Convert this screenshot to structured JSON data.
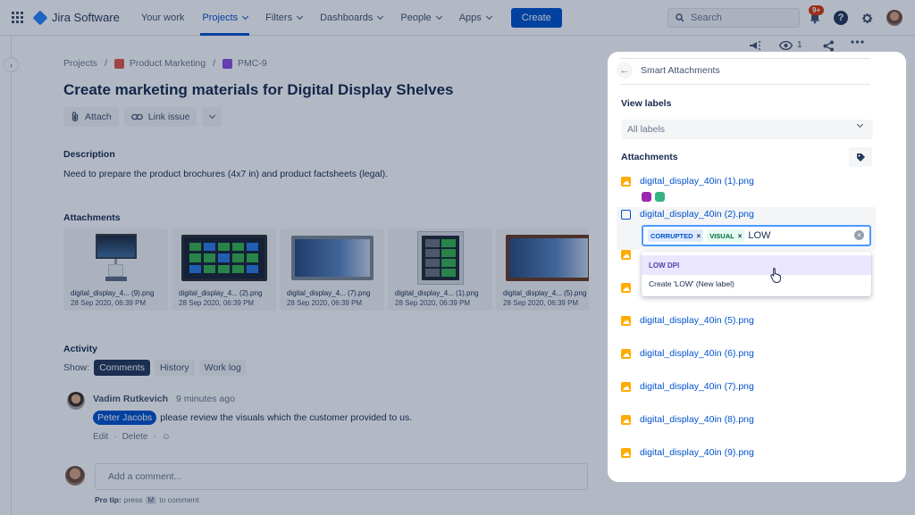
{
  "nav": {
    "product": "Jira Software",
    "items": [
      "Your work",
      "Projects",
      "Filters",
      "Dashboards",
      "People",
      "Apps"
    ],
    "create": "Create",
    "search_placeholder": "Search",
    "notifications": "9+"
  },
  "issue": {
    "breadcrumb": [
      "Projects",
      "Product Marketing",
      "PMC-9"
    ],
    "title": "Create marketing materials for Digital Display Shelves",
    "attach_label": "Attach",
    "link_label": "Link issue",
    "watchers": "1",
    "description_label": "Description",
    "description": "Need to prepare the product brochures (4x7 in) and product factsheets (legal).",
    "attachments_label": "Attachments",
    "attachments": [
      {
        "name": "digital_display_4... (9).png",
        "date": "28 Sep 2020, 06:39 PM"
      },
      {
        "name": "digital_display_4... (2).png",
        "date": "28 Sep 2020, 06:39 PM"
      },
      {
        "name": "digital_display_4... (7).png",
        "date": "28 Sep 2020, 06:39 PM"
      },
      {
        "name": "digital_display_4... (1).png",
        "date": "28 Sep 2020, 06:39 PM"
      },
      {
        "name": "digital_display_4... (5).png",
        "date": "28 Sep 2020, 06:39 PM"
      }
    ]
  },
  "activity": {
    "label": "Activity",
    "show": "Show:",
    "tabs": [
      "Comments",
      "History",
      "Work log"
    ],
    "comment": {
      "author": "Vadim Rutkevich",
      "time": "9 minutes ago",
      "mention": "Peter Jacobs",
      "text": "please review the visuals which the customer provided to us.",
      "edit": "Edit",
      "delete": "Delete"
    },
    "add_placeholder": "Add a comment...",
    "pro_tip_prefix": "Pro tip:",
    "pro_tip_press": "press",
    "pro_tip_key": "M",
    "pro_tip_suffix": "to comment"
  },
  "panel": {
    "title": "Smart Attachments",
    "view_labels": "View labels",
    "labels_select": "All labels",
    "attachments_label": "Attachments",
    "files": [
      "digital_display_40in (1).png",
      "digital_display_40in (2).png",
      "digital_display_40in (5).png",
      "digital_display_40in (6).png",
      "digital_display_40in (7).png",
      "digital_display_40in (8).png",
      "digital_display_40in (9).png"
    ],
    "label_dot_colors": [
      "#9c27b0",
      "#36b37e"
    ],
    "chips": [
      "CORRUPTED",
      "VISUAL"
    ],
    "typed": "LOW",
    "options": [
      "LOW DPI",
      "Create 'LOW' (New label)"
    ]
  }
}
